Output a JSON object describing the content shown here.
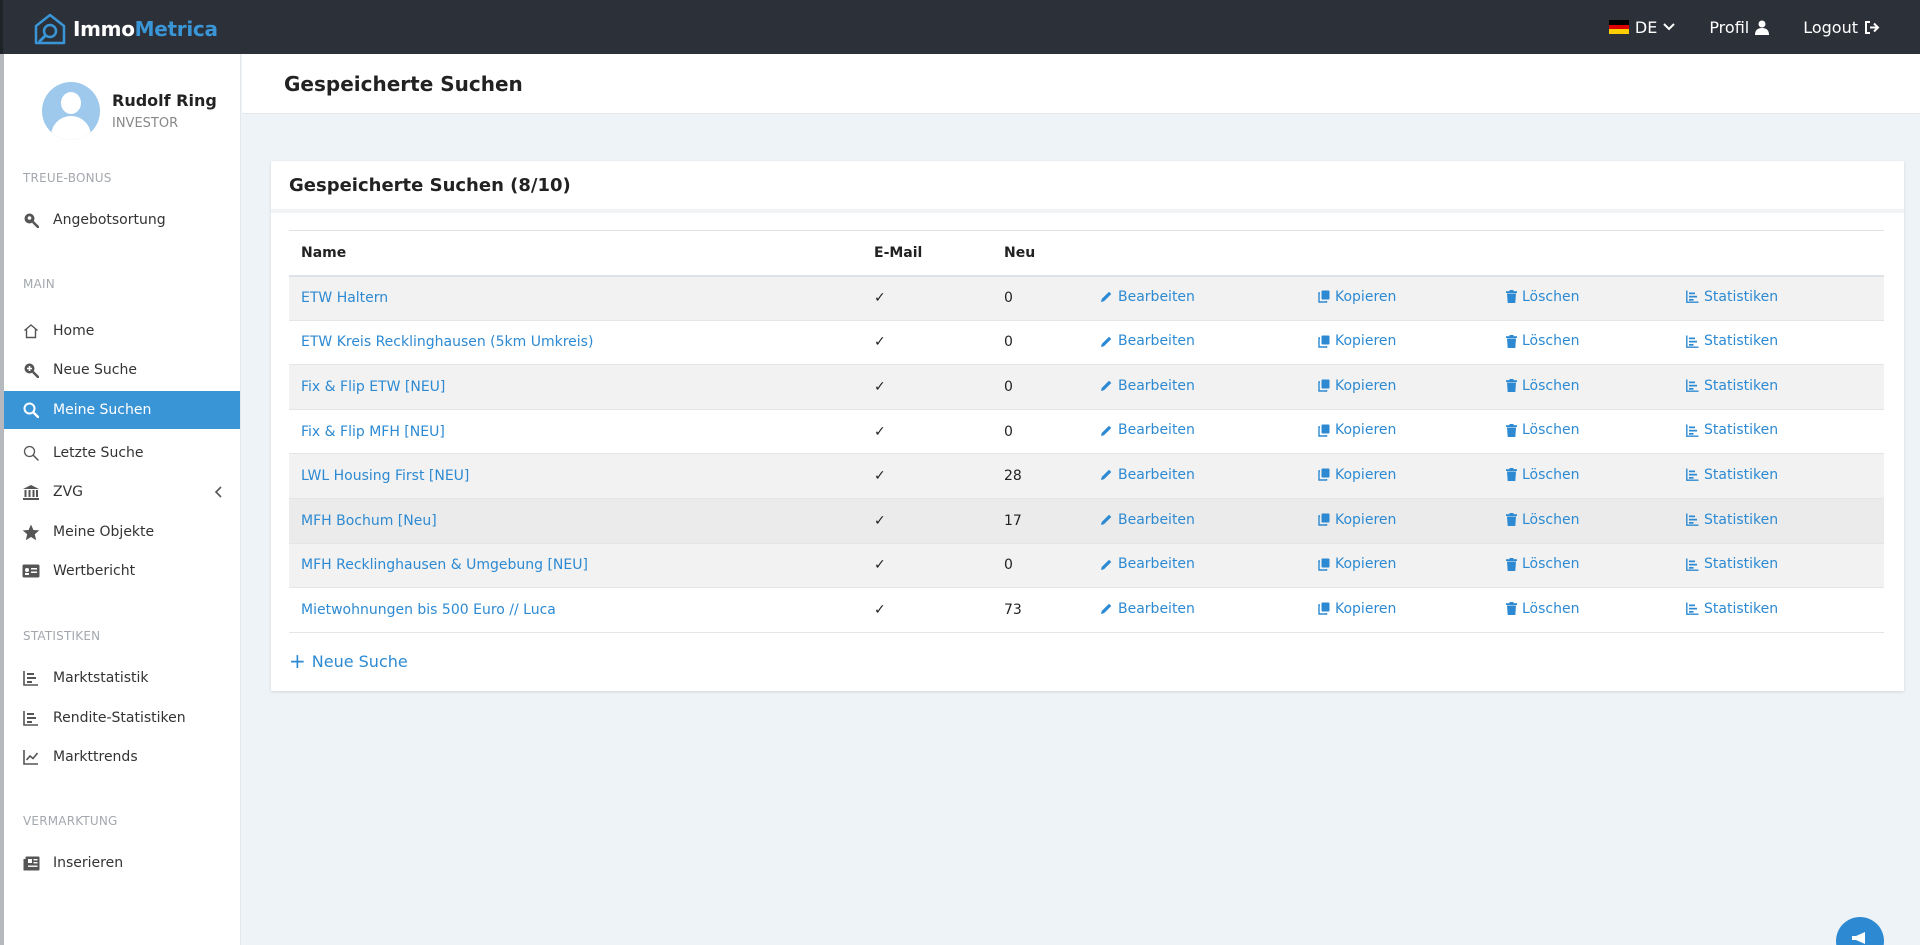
{
  "brand": {
    "part1": "Immo",
    "part2": "Metrica"
  },
  "topbar": {
    "language": "DE",
    "profile": "Profil",
    "logout": "Logout"
  },
  "user": {
    "name": "Rudolf Ring",
    "role": "INVESTOR"
  },
  "sidebar": {
    "sections": [
      {
        "title": "TREUE-BONUS"
      },
      {
        "title": "MAIN"
      },
      {
        "title": "STATISTIKEN"
      },
      {
        "title": "VERMARKTUNG"
      }
    ],
    "items": [
      {
        "label": "Angebotsortung",
        "icon": "search-location-icon"
      },
      {
        "label": "Home",
        "icon": "home-icon"
      },
      {
        "label": "Neue Suche",
        "icon": "search-plus-icon"
      },
      {
        "label": "Meine Suchen",
        "icon": "search-icon",
        "active": true
      },
      {
        "label": "Letzte Suche",
        "icon": "search-outline-icon"
      },
      {
        "label": "ZVG",
        "icon": "bank-icon"
      },
      {
        "label": "Meine Objekte",
        "icon": "star-icon"
      },
      {
        "label": "Wertbericht",
        "icon": "id-card-icon"
      },
      {
        "label": "Marktstatistik",
        "icon": "bar-chart-icon"
      },
      {
        "label": "Rendite-Statistiken",
        "icon": "bar-chart-icon"
      },
      {
        "label": "Markttrends",
        "icon": "line-chart-icon"
      },
      {
        "label": "Inserieren",
        "icon": "newspaper-icon"
      }
    ]
  },
  "page": {
    "title": "Gespeicherte Suchen"
  },
  "card": {
    "title": "Gespeicherte Suchen (8/10)",
    "columns": [
      "Name",
      "E-Mail",
      "Neu"
    ],
    "actions": {
      "edit": "Bearbeiten",
      "copy": "Kopieren",
      "delete": "Löschen",
      "stats": "Statistiken"
    },
    "rows": [
      {
        "name": "ETW Haltern",
        "email": "✓",
        "new": "0"
      },
      {
        "name": "ETW Kreis Recklinghausen (5km Umkreis)",
        "email": "✓",
        "new": "0"
      },
      {
        "name": "Fix & Flip ETW [NEU]",
        "email": "✓",
        "new": "0"
      },
      {
        "name": "Fix & Flip MFH [NEU]",
        "email": "✓",
        "new": "0"
      },
      {
        "name": "LWL Housing First [NEU]",
        "email": "✓",
        "new": "28"
      },
      {
        "name": "MFH Bochum [Neu]",
        "email": "✓",
        "new": "17"
      },
      {
        "name": "MFH Recklinghausen & Umgebung [NEU]",
        "email": "✓",
        "new": "0"
      },
      {
        "name": "Mietwohnungen bis 500 Euro // Luca",
        "email": "✓",
        "new": "73"
      }
    ],
    "add_label": "Neue Suche",
    "add_symbol": "+"
  },
  "colors": {
    "accent": "#3a95d7",
    "link": "#2d8ad2",
    "topbar": "#2c3038"
  }
}
